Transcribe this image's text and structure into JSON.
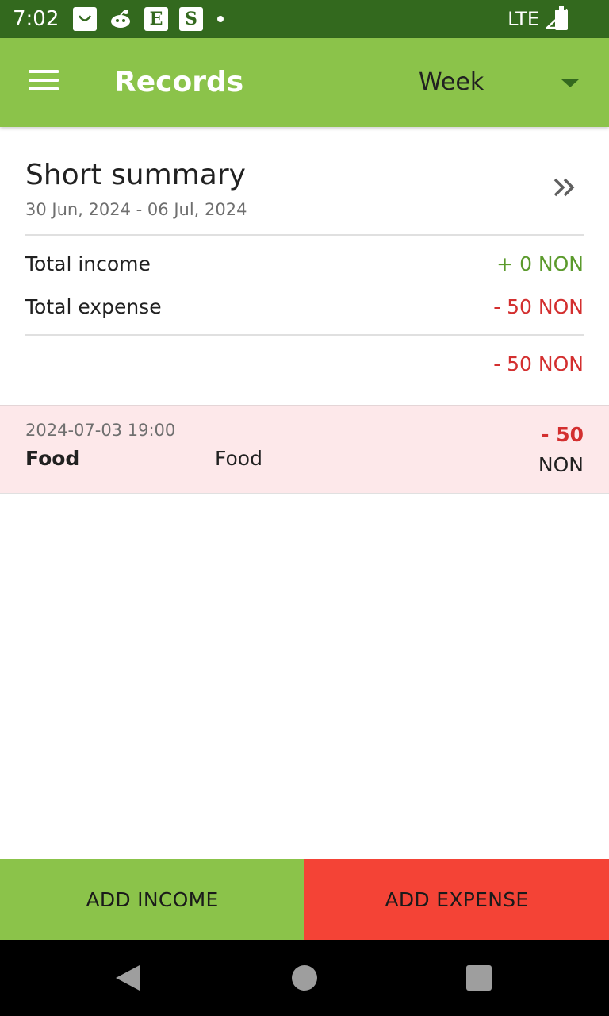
{
  "status_bar": {
    "time": "7:02",
    "notification_icons": [
      "shopping-bag-icon",
      "reddit-icon",
      "etsy-icon",
      "shopify-icon",
      "more-dot-icon"
    ],
    "etsy_letter": "E",
    "shopify_letter": "S",
    "network": "LTE",
    "signal_icon": "signal-icon",
    "battery_icon": "battery-icon"
  },
  "app_bar": {
    "title": "Records",
    "period": "Week",
    "color": "#8bc34a"
  },
  "summary": {
    "title": "Short summary",
    "date_range": "30 Jun, 2024 - 06 Jul, 2024",
    "income_label": "Total income",
    "income_value": "+ 0 NON",
    "expense_label": "Total expense",
    "expense_value": "- 50 NON",
    "balance_value": "- 50 NON"
  },
  "records": [
    {
      "datetime": "2024-07-03 19:00",
      "category": "Food",
      "note": "Food",
      "amount": "- 50",
      "currency": "NON"
    }
  ],
  "buttons": {
    "add_income": "ADD INCOME",
    "add_expense": "ADD EXPENSE"
  },
  "colors": {
    "status_bar": "#33691e",
    "income": "#5b9a2c",
    "expense": "#d32f2f",
    "income_button": "#8bc34a",
    "expense_button": "#f44336",
    "record_bg": "#fde8ea"
  }
}
